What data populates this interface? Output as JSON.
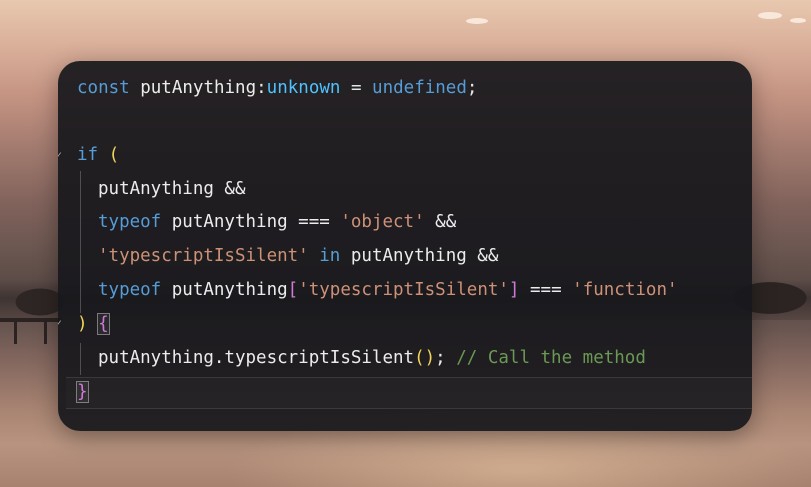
{
  "editor": {
    "theme_colors": {
      "background": "#18181c",
      "keyword": "#569cd6",
      "type": "#4ec9b0",
      "string": "#ce9178",
      "comment": "#6a9955",
      "bracket_level1": "#f2d45c",
      "bracket_level2": "#d07ad6"
    },
    "lines": {
      "l1": {
        "kw_const": "const",
        "ident": " putAnything",
        "colon": ":",
        "type": "unknown",
        "eq": " = ",
        "undef": "undefined",
        "semi": ";"
      },
      "l3": {
        "kw_if": "if",
        "sp": " ",
        "paren_open": "("
      },
      "l4": {
        "text": "putAnything &&"
      },
      "l5": {
        "kw_typeof": "typeof",
        "ident": " putAnything === ",
        "str": "'object'",
        "tail": " &&"
      },
      "l6": {
        "str": "'typescriptIsSilent'",
        "sp1": " ",
        "kw_in": "in",
        "tail": " putAnything &&"
      },
      "l7": {
        "kw_typeof": "typeof",
        "ident": " putAnything",
        "bracket_open": "[",
        "str1": "'typescriptIsSilent'",
        "bracket_close": "]",
        "eq": " === ",
        "str2": "'function'"
      },
      "l8": {
        "paren_close": ")",
        "sp": " ",
        "brace_open": "{"
      },
      "l9": {
        "ident": "putAnything.typescriptIsSilent",
        "call": "()",
        "semi": "; ",
        "comment": "// Call the method"
      },
      "l10": {
        "brace_close": "}"
      }
    },
    "fold_icons": [
      "chevron-fold-icon",
      "chevron-fold-icon"
    ]
  }
}
